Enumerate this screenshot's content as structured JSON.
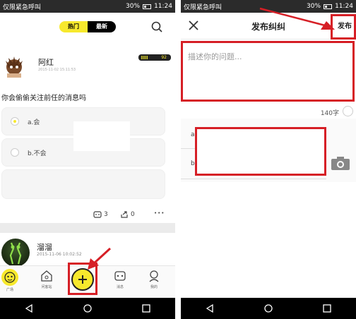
{
  "left": {
    "status": {
      "carrier": "仅限紧急呼叫",
      "battery": "30%",
      "time": "11:24"
    },
    "header": {
      "tab_hot": "热门",
      "tab_new": "最新",
      "search_icon": "search-icon"
    },
    "post1": {
      "username": "阿红",
      "time": "2015-11-02 15:11:53",
      "level": "92",
      "question": "你会偷偷关注前任的消息吗",
      "options": [
        {
          "label": "a.会",
          "selected": true
        },
        {
          "label": "b.不会",
          "selected": false
        }
      ],
      "comments": "3",
      "shares": "0",
      "more": "•••"
    },
    "post2": {
      "username": "溜溜",
      "time": "2015-11-06 10:02:52"
    },
    "tabs": [
      {
        "label": "广场",
        "icon": "monkey-face-icon"
      },
      {
        "label": "问客站",
        "icon": "house-icon"
      },
      {
        "label": "",
        "icon": "add-icon"
      },
      {
        "label": "消息",
        "icon": "message-icon"
      },
      {
        "label": "我的",
        "icon": "profile-icon"
      }
    ],
    "accent_color": "#f7e92d",
    "highlight_color": "#d61f26"
  },
  "right": {
    "status": {
      "carrier": "仅限紧急呼叫",
      "battery": "30%",
      "time": "11:24"
    },
    "header": {
      "title": "发布纠纠",
      "publish": "发布",
      "close_icon": "close-icon"
    },
    "description_placeholder": "描述你的问题...",
    "char_count": "140字",
    "options": [
      "a",
      "b"
    ],
    "camera_icon": "camera-icon"
  }
}
